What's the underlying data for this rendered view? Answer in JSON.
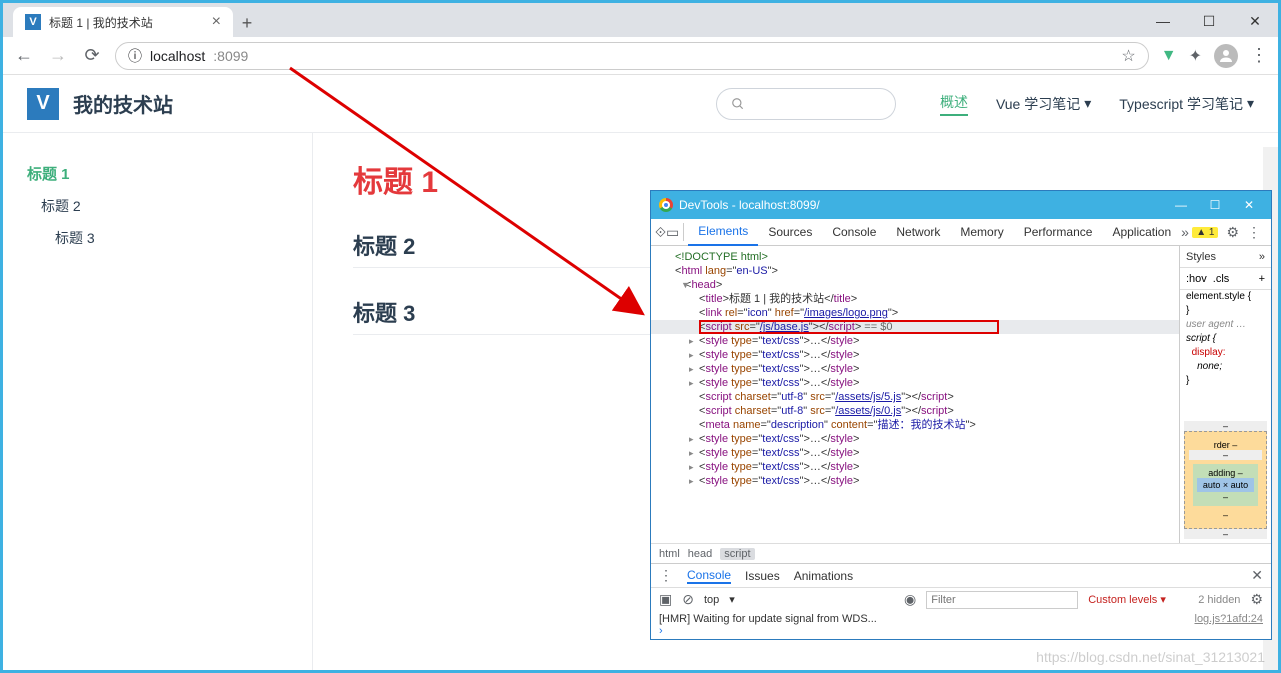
{
  "browser": {
    "tab_title": "标题 1 | 我的技术站",
    "url_info_icon": "ⓘ",
    "url_host": "localhost",
    "url_port": ":8099"
  },
  "page": {
    "site_title": "我的技术站",
    "nav": {
      "overview": "概述",
      "vue": "Vue 学习笔记",
      "ts": "Typescript 学习笔记"
    },
    "sidebar": {
      "h1": "标题 1",
      "h2": "标题 2",
      "h3": "标题 3"
    },
    "content": {
      "h1": "标题 1",
      "h2": "标题 2",
      "h3": "标题 3"
    }
  },
  "devtools": {
    "title": "DevTools - localhost:8099/",
    "tabs": {
      "elements": "Elements",
      "sources": "Sources",
      "console": "Console",
      "network": "Network",
      "memory": "Memory",
      "performance": "Performance",
      "application": "Application"
    },
    "warn_count": "1",
    "tree": {
      "doctype": "<!DOCTYPE html>",
      "html_open": "html",
      "html_lang_attr": "lang",
      "html_lang_val": "en-US",
      "head": "head",
      "title_tag": "title",
      "title_text": "标题 1 | 我的技术站",
      "link_tag": "link",
      "rel_attr": "rel",
      "rel_val": "icon",
      "href_attr": "href",
      "href_val": "/images/logo.png",
      "script_tag": "script",
      "src_attr": "src",
      "base_js": "/js/base.js",
      "suffix": " == $0",
      "style_tag": "style",
      "type_attr": "type",
      "type_val": "text/css",
      "ellip": "…",
      "charset_attr": "charset",
      "charset_val": "utf-8",
      "assets5": "/assets/js/5.js",
      "assets0": "/assets/js/0.js",
      "meta_tag": "meta",
      "name_attr": "name",
      "desc_val": "description",
      "content_attr": "content",
      "content_val": "描述：我的技术站"
    },
    "crumb": {
      "a": "html",
      "b": "head",
      "c": "script"
    },
    "styles": {
      "label": "Styles",
      "hov": ":hov",
      "cls": ".cls",
      "elstyle": "element.style {",
      "close": "}",
      "ua": "user agent …",
      "scripto": "script {",
      "disp": "display:",
      "none": "none;",
      "rder": "rder",
      "add": "adding",
      "auto": "auto × auto"
    },
    "console": {
      "tab_console": "Console",
      "tab_issues": "Issues",
      "tab_anim": "Animations",
      "ctx": "top",
      "filter_ph": "Filter",
      "levels": "Custom levels ▾",
      "hidden": "2 hidden",
      "log_msg": "[HMR] Waiting for update signal from WDS...",
      "log_src": "log.js?1afd:24"
    }
  },
  "watermark": "https://blog.csdn.net/sinat_31213021"
}
